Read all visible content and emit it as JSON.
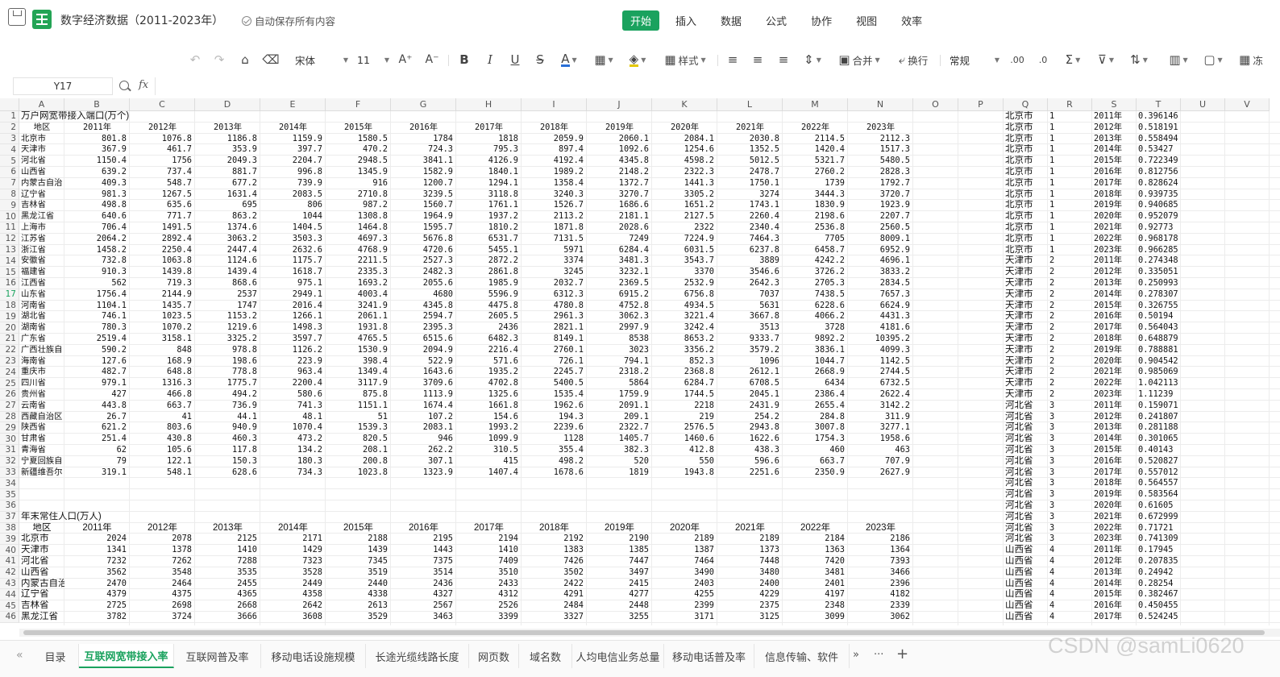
{
  "titlebar": {
    "doc_title": "数字经济数据（2011-2023年）",
    "autosave": "自动保存所有内容",
    "menu": [
      "开始",
      "插入",
      "数据",
      "公式",
      "协作",
      "视图",
      "效率"
    ],
    "active_menu": "开始"
  },
  "toolbar": {
    "font_name": "宋体",
    "font_size": "11",
    "style_label": "样式",
    "merge_label": "合并",
    "wrap_label": "换行",
    "number_format": "常规"
  },
  "formula": {
    "cell_ref": "Y17",
    "fx": "fx",
    "value": ""
  },
  "columns": [
    "A",
    "B",
    "C",
    "D",
    "E",
    "F",
    "G",
    "H",
    "I",
    "J",
    "K",
    "L",
    "M",
    "N",
    "O",
    "P",
    "Q",
    "R",
    "S",
    "T",
    "U",
    "V"
  ],
  "selected_row": 17,
  "table1": {
    "title": "万户网宽带接入端口(万个)",
    "header": [
      "地区",
      "2011年",
      "2012年",
      "2013年",
      "2014年",
      "2015年",
      "2016年",
      "2017年",
      "2018年",
      "2019年",
      "2020年",
      "2021年",
      "2022年",
      "2023年"
    ],
    "rows": [
      [
        "北京市",
        "801.8",
        "1076.8",
        "1186.8",
        "1159.9",
        "1580.5",
        "1784",
        "1818",
        "2059.9",
        "2060.1",
        "2084.1",
        "2030.8",
        "2114.5",
        "2112.3"
      ],
      [
        "天津市",
        "367.9",
        "461.7",
        "353.9",
        "397.7",
        "470.2",
        "724.3",
        "795.3",
        "897.4",
        "1092.6",
        "1254.6",
        "1352.5",
        "1420.4",
        "1517.3"
      ],
      [
        "河北省",
        "1150.4",
        "1756",
        "2049.3",
        "2204.7",
        "2948.5",
        "3841.1",
        "4126.9",
        "4192.4",
        "4345.8",
        "4598.2",
        "5012.5",
        "5321.7",
        "5480.5"
      ],
      [
        "山西省",
        "639.2",
        "737.4",
        "881.7",
        "996.8",
        "1345.9",
        "1582.9",
        "1840.1",
        "1989.2",
        "2148.2",
        "2322.3",
        "2478.7",
        "2760.2",
        "2828.3"
      ],
      [
        "内蒙古自治",
        "409.3",
        "548.7",
        "677.2",
        "739.9",
        "916",
        "1200.7",
        "1294.1",
        "1358.4",
        "1372.7",
        "1441.3",
        "1750.1",
        "1739",
        "1792.7"
      ],
      [
        "辽宁省",
        "981.3",
        "1267.5",
        "1631.4",
        "2083.5",
        "2710.8",
        "3239.5",
        "3118.8",
        "3240.3",
        "3270.7",
        "3305.2",
        "3274",
        "3444.3",
        "3720.7"
      ],
      [
        "吉林省",
        "498.8",
        "635.6",
        "695",
        "806",
        "987.2",
        "1560.7",
        "1761.1",
        "1526.7",
        "1686.6",
        "1651.2",
        "1743.1",
        "1830.9",
        "1923.9"
      ],
      [
        "黑龙江省",
        "640.6",
        "771.7",
        "863.2",
        "1044",
        "1308.8",
        "1964.9",
        "1937.2",
        "2113.2",
        "2181.1",
        "2127.5",
        "2260.4",
        "2198.6",
        "2207.7"
      ],
      [
        "上海市",
        "706.4",
        "1491.5",
        "1374.6",
        "1404.5",
        "1464.8",
        "1595.7",
        "1810.2",
        "1871.8",
        "2028.6",
        "2322",
        "2340.4",
        "2536.8",
        "2560.5"
      ],
      [
        "江苏省",
        "2064.2",
        "2892.4",
        "3063.2",
        "3503.3",
        "4697.3",
        "5676.8",
        "6531.7",
        "7131.5",
        "7249",
        "7224.9",
        "7464.3",
        "7705",
        "8009.1"
      ],
      [
        "浙江省",
        "1458.2",
        "2250.4",
        "2447.4",
        "2632.6",
        "4768.9",
        "4720.6",
        "5455.1",
        "5971",
        "6284.4",
        "6031.5",
        "6237.8",
        "6458.7",
        "6952.9"
      ],
      [
        "安徽省",
        "732.8",
        "1063.8",
        "1124.6",
        "1175.7",
        "2211.5",
        "2527.3",
        "2872.2",
        "3374",
        "3481.3",
        "3543.7",
        "3889",
        "4242.2",
        "4696.1"
      ],
      [
        "福建省",
        "910.3",
        "1439.8",
        "1439.4",
        "1618.7",
        "2335.3",
        "2482.3",
        "2861.8",
        "3245",
        "3232.1",
        "3370",
        "3546.6",
        "3726.2",
        "3833.2"
      ],
      [
        "江西省",
        "562",
        "719.3",
        "868.6",
        "975.1",
        "1693.2",
        "2055.6",
        "1985.9",
        "2032.7",
        "2369.5",
        "2532.9",
        "2642.3",
        "2705.3",
        "2834.5"
      ],
      [
        "山东省",
        "1756.4",
        "2144.9",
        "2537",
        "2949.1",
        "4003.4",
        "4680",
        "5596.9",
        "6312.3",
        "6915.2",
        "6756.8",
        "7037",
        "7438.5",
        "7657.3"
      ],
      [
        "河南省",
        "1104.1",
        "1435.7",
        "1747",
        "2016.4",
        "3241.9",
        "4345.8",
        "4475.8",
        "4780.8",
        "4752.8",
        "4934.5",
        "5631",
        "6228.6",
        "6624.9"
      ],
      [
        "湖北省",
        "746.1",
        "1023.5",
        "1153.2",
        "1266.1",
        "2061.1",
        "2594.7",
        "2605.5",
        "2961.3",
        "3062.3",
        "3221.4",
        "3667.8",
        "4066.2",
        "4431.3"
      ],
      [
        "湖南省",
        "780.3",
        "1070.2",
        "1219.6",
        "1498.3",
        "1931.8",
        "2395.3",
        "2436",
        "2821.1",
        "2997.9",
        "3242.4",
        "3513",
        "3728",
        "4181.6"
      ],
      [
        "广东省",
        "2519.4",
        "3158.1",
        "3325.2",
        "3597.7",
        "4765.5",
        "6515.6",
        "6482.3",
        "8149.1",
        "8538",
        "8653.2",
        "9333.7",
        "9892.2",
        "10395.2"
      ],
      [
        "广西壮族自",
        "590.2",
        "848",
        "978.8",
        "1126.2",
        "1530.9",
        "2094.9",
        "2216.4",
        "2760.1",
        "3023",
        "3356.2",
        "3579.2",
        "3836.1",
        "4099.3"
      ],
      [
        "海南省",
        "127.6",
        "168.9",
        "198.6",
        "223.9",
        "398.4",
        "522.9",
        "571.6",
        "726.1",
        "794.1",
        "852.3",
        "1096",
        "1044.7",
        "1142.5"
      ],
      [
        "重庆市",
        "482.7",
        "648.8",
        "778.8",
        "963.4",
        "1349.4",
        "1643.6",
        "1935.2",
        "2245.7",
        "2318.2",
        "2368.8",
        "2612.1",
        "2668.9",
        "2744.5"
      ],
      [
        "四川省",
        "979.1",
        "1316.3",
        "1775.7",
        "2200.4",
        "3117.9",
        "3709.6",
        "4702.8",
        "5400.5",
        "5864",
        "6284.7",
        "6708.5",
        "6434",
        "6732.5"
      ],
      [
        "贵州省",
        "427",
        "466.8",
        "494.2",
        "580.6",
        "875.8",
        "1113.9",
        "1325.6",
        "1535.4",
        "1759.9",
        "1744.5",
        "2045.1",
        "2386.4",
        "2622.4"
      ],
      [
        "云南省",
        "443.8",
        "663.7",
        "736.9",
        "741.3",
        "1151.1",
        "1674.4",
        "1661.8",
        "1962.6",
        "2091.1",
        "2218",
        "2431.9",
        "2655.4",
        "3142.2"
      ],
      [
        "西藏自治区",
        "26.7",
        "41",
        "44.1",
        "48.1",
        "51",
        "107.2",
        "154.6",
        "194.3",
        "209.1",
        "219",
        "254.2",
        "284.8",
        "311.9"
      ],
      [
        "陕西省",
        "621.2",
        "803.6",
        "940.9",
        "1070.4",
        "1539.3",
        "2083.1",
        "1993.2",
        "2239.6",
        "2322.7",
        "2576.5",
        "2943.8",
        "3007.8",
        "3277.1"
      ],
      [
        "甘肃省",
        "251.4",
        "430.8",
        "460.3",
        "473.2",
        "820.5",
        "946",
        "1099.9",
        "1128",
        "1405.7",
        "1460.6",
        "1622.6",
        "1754.3",
        "1958.6"
      ],
      [
        "青海省",
        "62",
        "105.6",
        "117.8",
        "134.2",
        "208.1",
        "262.2",
        "310.5",
        "355.4",
        "382.3",
        "412.8",
        "438.3",
        "460",
        "463"
      ],
      [
        "宁夏回族自",
        "79",
        "122.1",
        "150.3",
        "180.3",
        "200.8",
        "307.1",
        "415",
        "498.2",
        "520",
        "550",
        "596.6",
        "663.7",
        "707.9"
      ],
      [
        "新疆维吾尔",
        "319.1",
        "548.1",
        "628.6",
        "734.3",
        "1023.8",
        "1323.9",
        "1407.4",
        "1678.6",
        "1819",
        "1943.8",
        "2251.6",
        "2350.9",
        "2627.9"
      ]
    ]
  },
  "table2": {
    "title": "年末常住人口(万人)",
    "header": [
      "地区",
      "2011年",
      "2012年",
      "2013年",
      "2014年",
      "2015年",
      "2016年",
      "2017年",
      "2018年",
      "2019年",
      "2020年",
      "2021年",
      "2022年",
      "2023年"
    ],
    "rows": [
      [
        "北京市",
        "2024",
        "2078",
        "2125",
        "2171",
        "2188",
        "2195",
        "2194",
        "2192",
        "2190",
        "2189",
        "2189",
        "2184",
        "2186"
      ],
      [
        "天津市",
        "1341",
        "1378",
        "1410",
        "1429",
        "1439",
        "1443",
        "1410",
        "1383",
        "1385",
        "1387",
        "1373",
        "1363",
        "1364"
      ],
      [
        "河北省",
        "7232",
        "7262",
        "7288",
        "7323",
        "7345",
        "7375",
        "7409",
        "7426",
        "7447",
        "7464",
        "7448",
        "7420",
        "7393"
      ],
      [
        "山西省",
        "3562",
        "3548",
        "3535",
        "3528",
        "3519",
        "3514",
        "3510",
        "3502",
        "3497",
        "3490",
        "3480",
        "3481",
        "3466"
      ],
      [
        "内蒙古自治",
        "2470",
        "2464",
        "2455",
        "2449",
        "2440",
        "2436",
        "2433",
        "2422",
        "2415",
        "2403",
        "2400",
        "2401",
        "2396"
      ],
      [
        "辽宁省",
        "4379",
        "4375",
        "4365",
        "4358",
        "4338",
        "4327",
        "4312",
        "4291",
        "4277",
        "4255",
        "4229",
        "4197",
        "4182"
      ],
      [
        "吉林省",
        "2725",
        "2698",
        "2668",
        "2642",
        "2613",
        "2567",
        "2526",
        "2484",
        "2448",
        "2399",
        "2375",
        "2348",
        "2339"
      ],
      [
        "黑龙江省",
        "3782",
        "3724",
        "3666",
        "3608",
        "3529",
        "3463",
        "3399",
        "3327",
        "3255",
        "3171",
        "3125",
        "3099",
        "3062"
      ]
    ]
  },
  "side_table": {
    "rows": [
      [
        "北京市",
        "1",
        "2011年",
        "0.396146"
      ],
      [
        "北京市",
        "1",
        "2012年",
        "0.518191"
      ],
      [
        "北京市",
        "1",
        "2013年",
        "0.558494"
      ],
      [
        "北京市",
        "1",
        "2014年",
        "0.53427"
      ],
      [
        "北京市",
        "1",
        "2015年",
        "0.722349"
      ],
      [
        "北京市",
        "1",
        "2016年",
        "0.812756"
      ],
      [
        "北京市",
        "1",
        "2017年",
        "0.828624"
      ],
      [
        "北京市",
        "1",
        "2018年",
        "0.939735"
      ],
      [
        "北京市",
        "1",
        "2019年",
        "0.940685"
      ],
      [
        "北京市",
        "1",
        "2020年",
        "0.952079"
      ],
      [
        "北京市",
        "1",
        "2021年",
        "0.92773"
      ],
      [
        "北京市",
        "1",
        "2022年",
        "0.968178"
      ],
      [
        "北京市",
        "1",
        "2023年",
        "0.966285"
      ],
      [
        "天津市",
        "2",
        "2011年",
        "0.274348"
      ],
      [
        "天津市",
        "2",
        "2012年",
        "0.335051"
      ],
      [
        "天津市",
        "2",
        "2013年",
        "0.250993"
      ],
      [
        "天津市",
        "2",
        "2014年",
        "0.278307"
      ],
      [
        "天津市",
        "2",
        "2015年",
        "0.326755"
      ],
      [
        "天津市",
        "2",
        "2016年",
        "0.50194"
      ],
      [
        "天津市",
        "2",
        "2017年",
        "0.564043"
      ],
      [
        "天津市",
        "2",
        "2018年",
        "0.648879"
      ],
      [
        "天津市",
        "2",
        "2019年",
        "0.788881"
      ],
      [
        "天津市",
        "2",
        "2020年",
        "0.904542"
      ],
      [
        "天津市",
        "2",
        "2021年",
        "0.985069"
      ],
      [
        "天津市",
        "2",
        "2022年",
        "1.042113"
      ],
      [
        "天津市",
        "2",
        "2023年",
        "1.11239"
      ],
      [
        "河北省",
        "3",
        "2011年",
        "0.159071"
      ],
      [
        "河北省",
        "3",
        "2012年",
        "0.241807"
      ],
      [
        "河北省",
        "3",
        "2013年",
        "0.281188"
      ],
      [
        "河北省",
        "3",
        "2014年",
        "0.301065"
      ],
      [
        "河北省",
        "3",
        "2015年",
        "0.40143"
      ],
      [
        "河北省",
        "3",
        "2016年",
        "0.520827"
      ],
      [
        "河北省",
        "3",
        "2017年",
        "0.557012"
      ],
      [
        "河北省",
        "3",
        "2018年",
        "0.564557"
      ],
      [
        "河北省",
        "3",
        "2019年",
        "0.583564"
      ],
      [
        "河北省",
        "3",
        "2020年",
        "0.61605"
      ],
      [
        "河北省",
        "3",
        "2021年",
        "0.672999"
      ],
      [
        "河北省",
        "3",
        "2022年",
        "0.71721"
      ],
      [
        "河北省",
        "3",
        "2023年",
        "0.741309"
      ],
      [
        "山西省",
        "4",
        "2011年",
        "0.17945"
      ],
      [
        "山西省",
        "4",
        "2012年",
        "0.207835"
      ],
      [
        "山西省",
        "4",
        "2013年",
        "0.24942"
      ],
      [
        "山西省",
        "4",
        "2014年",
        "0.28254"
      ],
      [
        "山西省",
        "4",
        "2015年",
        "0.382467"
      ],
      [
        "山西省",
        "4",
        "2016年",
        "0.450455"
      ],
      [
        "山西省",
        "4",
        "2017年",
        "0.524245"
      ]
    ]
  },
  "sheets": [
    "目录",
    "互联网宽带接入率",
    "互联网普及率",
    "移动电话设施规模",
    "长途光缆线路长度",
    "网页数",
    "域名数",
    "人均电信业务总量",
    "移动电话普及率",
    "信息传输、软件"
  ],
  "active_sheet": "互联网宽带接入率",
  "sheet_more": "···",
  "sheet_add": "+",
  "sheet_next": "»",
  "sheet_first": "«",
  "watermark": "CSDN @samLi0620"
}
